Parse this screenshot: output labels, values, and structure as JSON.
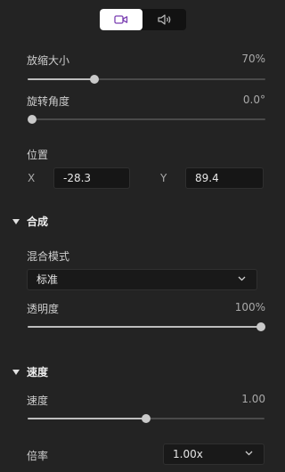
{
  "toggle": {
    "video_icon": "video-camera-icon",
    "audio_icon": "speaker-icon",
    "active": "video",
    "accent": "#7b3fb2"
  },
  "scale": {
    "label": "放缩大小",
    "value": "70%",
    "level": 0.28
  },
  "rotate": {
    "label": "旋转角度",
    "value": "0.0°",
    "level": 0.0
  },
  "position": {
    "label": "位置",
    "x_label": "X",
    "x_value": "-28.3",
    "y_label": "Y",
    "y_value": "89.4"
  },
  "composite": {
    "title": "合成",
    "blend_label": "混合模式",
    "blend_value": "标准",
    "opacity_label": "透明度",
    "opacity_value": "100%",
    "opacity_level": 1.0
  },
  "speed": {
    "title": "速度",
    "speed_label": "速度",
    "speed_value": "1.00",
    "speed_level": 0.5,
    "rate_label": "倍率",
    "rate_value": "1.00x"
  }
}
